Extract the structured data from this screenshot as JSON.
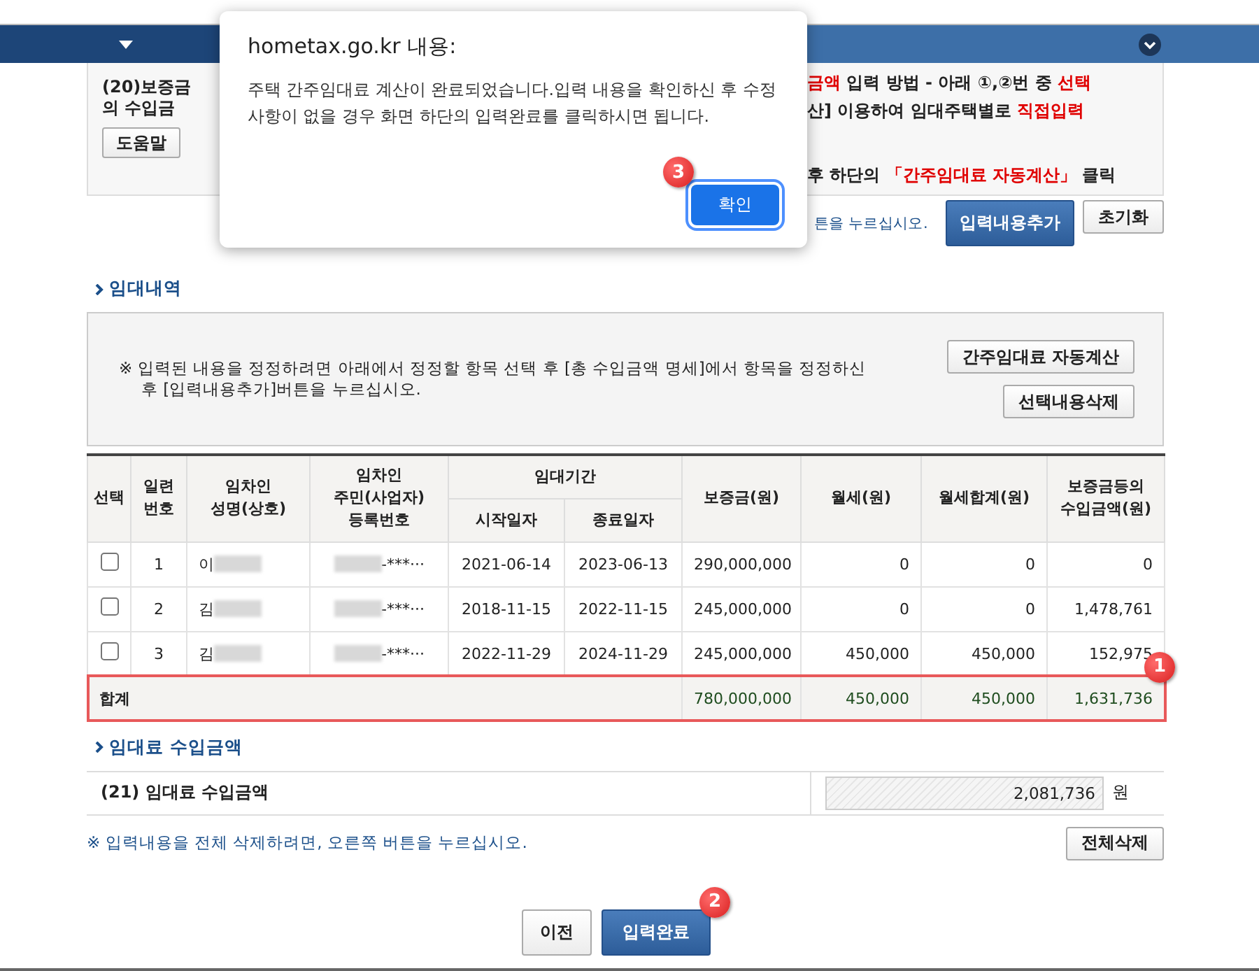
{
  "dialog": {
    "title": "hometax.go.kr 내용:",
    "message": "주택 간주임대료 계산이 완료되었습니다.입력 내용을 확인하신 후 수정 사항이 없을 경우 화면 하단의 입력완료를 클릭하시면 됩니다.",
    "button": "확인",
    "marker": "3"
  },
  "info_panel": {
    "left_lines": [
      "(20)보증금",
      "의 수입금"
    ],
    "help_button": "도움말",
    "right_lines": [
      [
        {
          "text": "금액",
          "red": true
        },
        {
          "text": " 입력 방법 - 아래 ①,②번 중 ",
          "red": false
        },
        {
          "text": "선택",
          "red": true
        }
      ],
      [
        {
          "text": "산] 이용하여 임대주택별로 ",
          "red": false
        },
        {
          "text": "직접입력",
          "red": true
        }
      ],
      [
        {
          "text": "후 하단의 ",
          "red": false
        },
        {
          "text": "「간주임대료 자동계산」",
          "red": true
        },
        {
          "text": " 클릭",
          "red": false
        }
      ]
    ]
  },
  "action_row": {
    "hint": "튼을 누르십시오.",
    "buttons": [
      {
        "label": "입력내용추가",
        "primary": true
      },
      {
        "label": "초기화",
        "primary": false
      }
    ]
  },
  "rental_section": {
    "title": "임대내역",
    "note": "※ 입력된 내용을 정정하려면 아래에서 정정할 항목 선택 후 [총 수입금액 명세]에서 항목을 정정하신 후 [입력내용추가]버튼을 누르십시오.",
    "buttons": [
      "간주임대료 자동계산",
      "선택내용삭제"
    ]
  },
  "table": {
    "headers": {
      "select": "선택",
      "serial": [
        "일련",
        "번호"
      ],
      "name": [
        "임차인",
        "성명(상호)"
      ],
      "reg": [
        "임차인",
        "주민(사업자)",
        "등록번호"
      ],
      "period": "임대기간",
      "start": "시작일자",
      "end": "종료일자",
      "deposit": "보증금(원)",
      "rent": "월세(원)",
      "rent_total": "월세합계(원)",
      "income": [
        "보증금등의",
        "수입금액(원)"
      ]
    },
    "rows": [
      {
        "checked": false,
        "serial": "1",
        "name": "이",
        "reg": "-***···",
        "start": "2021-06-14",
        "end": "2023-06-13",
        "deposit": "290,000,000",
        "rent": "0",
        "rent_total": "0",
        "income": "0"
      },
      {
        "checked": false,
        "serial": "2",
        "name": "김",
        "reg": "-***···",
        "start": "2018-11-15",
        "end": "2022-11-15",
        "deposit": "245,000,000",
        "rent": "0",
        "rent_total": "0",
        "income": "1,478,761"
      },
      {
        "checked": false,
        "serial": "3",
        "name": "김",
        "reg": "-***···",
        "start": "2022-11-29",
        "end": "2024-11-29",
        "deposit": "245,000,000",
        "rent": "450,000",
        "rent_total": "450,000",
        "income": "152,975"
      }
    ],
    "total": {
      "label": "합계",
      "deposit": "780,000,000",
      "rent": "450,000",
      "rent_total": "450,000",
      "income": "1,631,736",
      "highlighted": true,
      "marker": "1"
    }
  },
  "income_section": {
    "title": "임대료 수입금액",
    "label": "(21) 임대료 수입금액",
    "value": "2,081,736",
    "unit": "원"
  },
  "delete_row": {
    "note": "※ 입력내용을 전체 삭제하려면, 오른쪽 버튼을 누르십시오.",
    "button": "전체삭제"
  },
  "footer_buttons": [
    {
      "label": "이전",
      "primary": false
    },
    {
      "label": "입력완료",
      "primary": true,
      "marker": "2"
    }
  ]
}
